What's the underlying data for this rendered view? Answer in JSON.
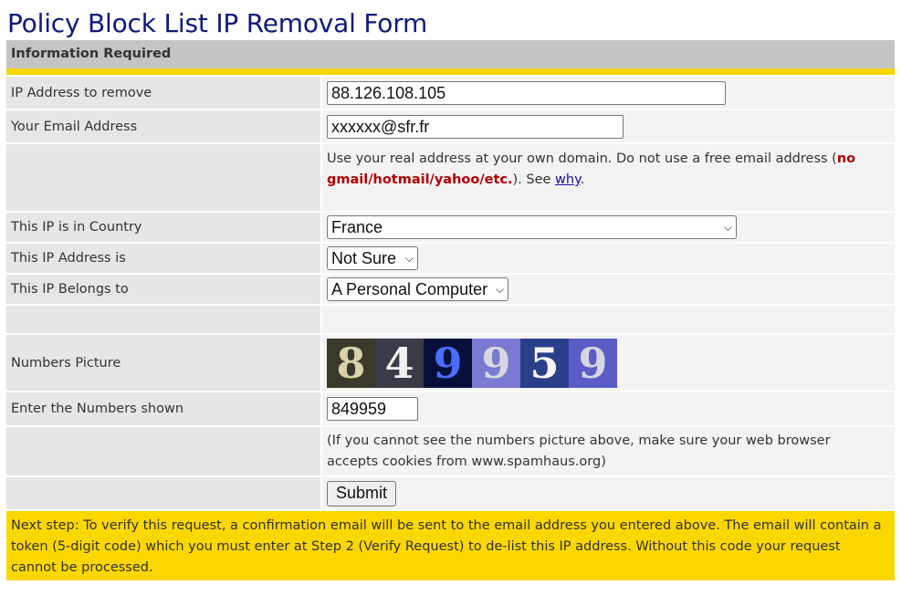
{
  "page": {
    "title": "Policy Block List IP Removal Form"
  },
  "section": {
    "header": "Information Required"
  },
  "fields": {
    "ip": {
      "label": "IP Address to remove",
      "value": "88.126.108.105"
    },
    "email": {
      "label": "Your Email Address",
      "value": "xxxxxx@sfr.fr",
      "note_before": "Use your real address at your own domain. Do not use a free email address (",
      "note_warning": "no gmail/hotmail/yahoo/etc.",
      "note_after": "). See ",
      "note_link": "why",
      "note_end": "."
    },
    "country": {
      "label": "This IP is in Country",
      "value": "France"
    },
    "address_type": {
      "label": "This IP Address is",
      "value": "Not Sure"
    },
    "belongs": {
      "label": "This IP Belongs to",
      "value": "A Personal Computer"
    },
    "captcha": {
      "label": "Numbers Picture",
      "digits": [
        "8",
        "4",
        "9",
        "9",
        "5",
        "9"
      ],
      "tile_colors": [
        "#3b3a2a",
        "#3a3b48",
        "#06103a",
        "#7a7ad2",
        "#2a3f8a",
        "#5c5cc8"
      ],
      "digit_colors": [
        "#d8d3a8",
        "#f0f0f0",
        "#4a6cff",
        "#d8d8e0",
        "#f4f4f4",
        "#d6d6e2"
      ]
    },
    "numbers": {
      "label": "Enter the Numbers shown",
      "value": "849959",
      "note": "(If you cannot see the numbers picture above, make sure your web browser accepts cookies from www.spamhaus.org)"
    }
  },
  "submit_label": "Submit",
  "footer": {
    "text": "Next step: To verify this request, a confirmation email will be sent to the email address you entered above. The email will contain a token (5-digit code) which you must enter at Step 2 (Verify Request) to de-list this IP address. Without this code your request cannot be processed."
  },
  "colors": {
    "title": "#0b1a7a",
    "header_bar": "#c4c4c4",
    "accent_yellow": "#fbd700",
    "warning_red": "#b00000"
  }
}
